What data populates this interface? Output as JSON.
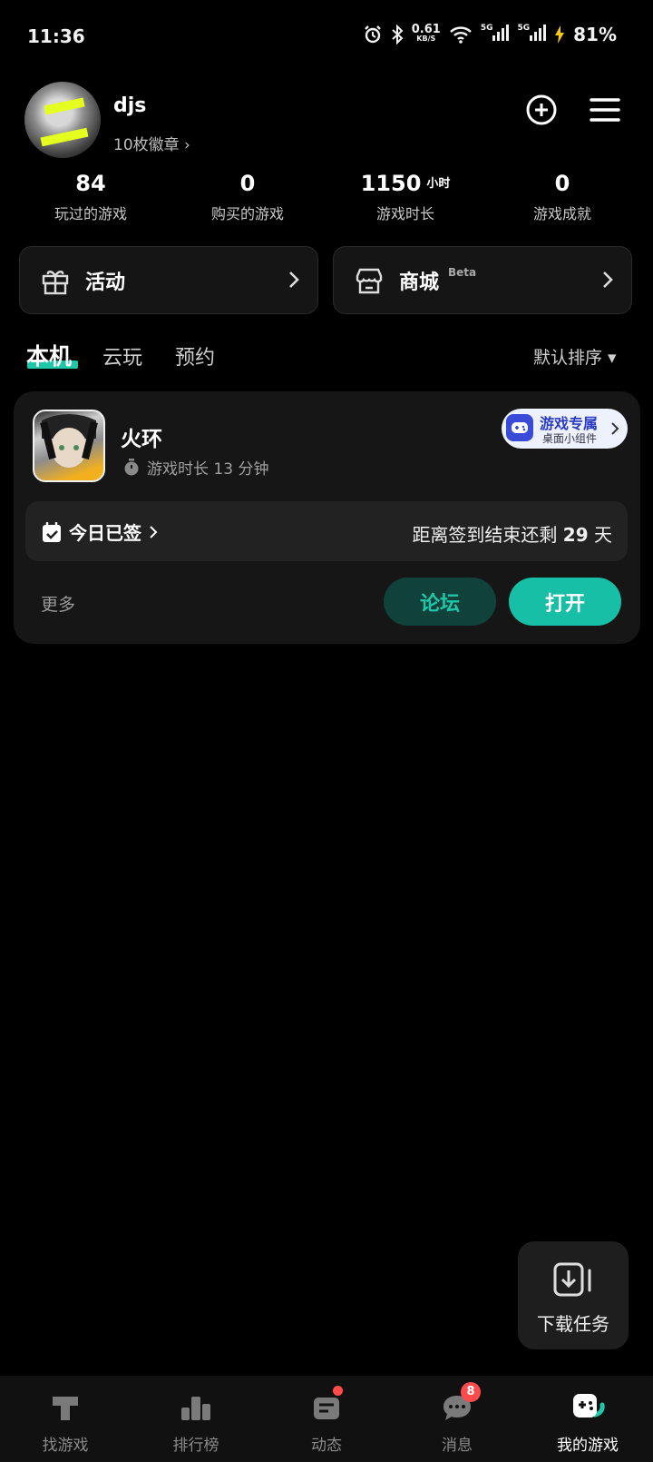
{
  "status_bar": {
    "time": "11:36",
    "net_speed": "0.61",
    "net_unit": "KB/S",
    "sim1": "5G",
    "sim2": "5G",
    "battery": "81%"
  },
  "profile": {
    "username": "djs",
    "badges": "10枚徽章 ›"
  },
  "stats": [
    {
      "value": "84",
      "unit": "",
      "label": "玩过的游戏"
    },
    {
      "value": "0",
      "unit": "",
      "label": "购买的游戏"
    },
    {
      "value": "1150",
      "unit": "小时",
      "label": "游戏时长"
    },
    {
      "value": "0",
      "unit": "",
      "label": "游戏成就"
    }
  ],
  "cards": {
    "activity": {
      "title": "活动",
      "icon": "gift-icon"
    },
    "store": {
      "title": "商城",
      "tag": "Beta",
      "icon": "store-icon"
    }
  },
  "tabs": [
    "本机",
    "云玩",
    "预约"
  ],
  "sort_label": "默认排序 ▾",
  "game": {
    "name": "火环",
    "playtime": "游戏时长 13 分钟",
    "widget_line1": "游戏专属",
    "widget_line2": "桌面小组件",
    "signed_in": "今日已签",
    "remaining_prefix": "距离签到结束还剩",
    "remaining_days": "29",
    "remaining_suffix": "天",
    "more": "更多",
    "forum_button": "论坛",
    "open_button": "打开"
  },
  "download_tasks": "下载任务",
  "bottom_nav": [
    {
      "label": "找游戏",
      "icon": "find-games-icon"
    },
    {
      "label": "排行榜",
      "icon": "ranking-icon"
    },
    {
      "label": "动态",
      "icon": "feed-icon"
    },
    {
      "label": "消息",
      "icon": "message-icon",
      "badge": "8"
    },
    {
      "label": "我的游戏",
      "icon": "my-games-icon"
    }
  ],
  "colors": {
    "accent": "#1ec7a8",
    "background": "#000000",
    "badge": "#ff4b4b"
  }
}
